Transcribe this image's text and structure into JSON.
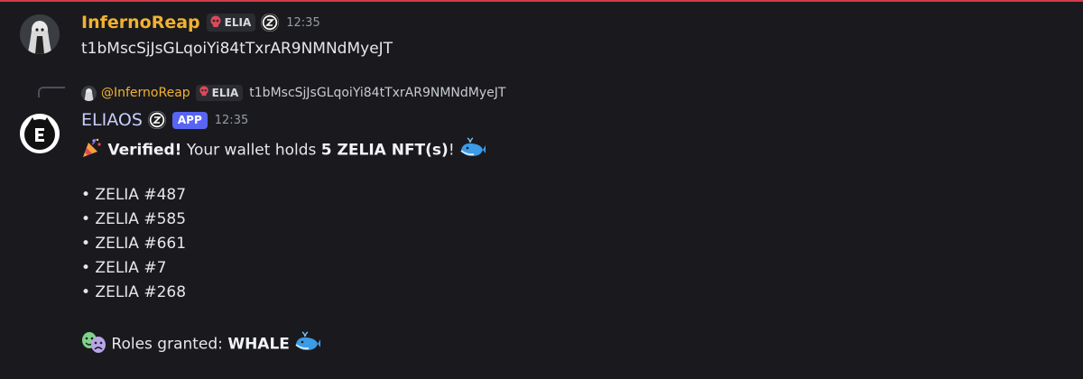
{
  "msg1": {
    "username": "InfernoReap",
    "username_color": "#f0b232",
    "role_label": "ELIA",
    "timestamp": "12:35",
    "text": "t1bMscSjJsGLqoiYi84tTxrAR9NMNdMyeJT"
  },
  "reply": {
    "username": "@InfernoReap",
    "role_label": "ELIA",
    "text": "t1bMscSjJsGLqoiYi84tTxrAR9NMNdMyeJT"
  },
  "msg2": {
    "username": "ELIAOS",
    "username_color": "#c9cdfb",
    "app_badge": "APP",
    "timestamp": "12:35",
    "verified_label": "Verified!",
    "verified_rest": " Your wallet holds ",
    "nft_count": "5 ZELIA NFT(s)",
    "exclaim": "!",
    "nfts": [
      "• ZELIA #487",
      "• ZELIA #585",
      "• ZELIA #661",
      "• ZELIA #7",
      "• ZELIA #268"
    ],
    "roles_prefix": "Roles granted: ",
    "roles_value": "WHALE"
  },
  "icons": {
    "party": "party-popper-icon",
    "whale": "whale-icon",
    "masks": "performing-arts-icon",
    "skull": "skull-icon",
    "zelia": "zelia-coin-icon"
  }
}
